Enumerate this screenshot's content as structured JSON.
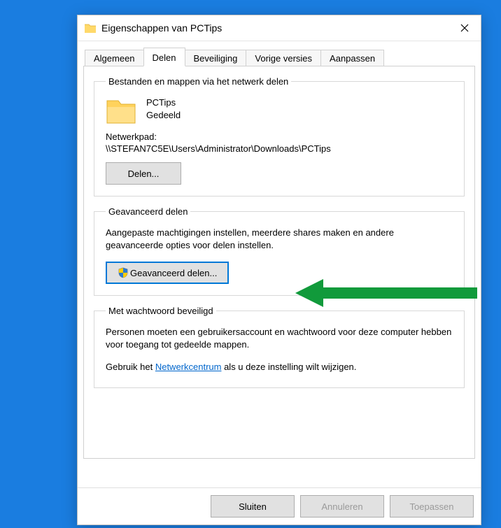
{
  "window": {
    "title": "Eigenschappen van PCTips"
  },
  "tabs": {
    "general": "Algemeen",
    "sharing": "Delen",
    "security": "Beveiliging",
    "previous": "Vorige versies",
    "customize": "Aanpassen"
  },
  "share": {
    "group_title": "Bestanden en mappen via het netwerk delen",
    "name": "PCTips",
    "status": "Gedeeld",
    "path_label": "Netwerkpad:",
    "path_value": "\\\\STEFAN7C5E\\Users\\Administrator\\Downloads\\PCTips",
    "share_btn": "Delen..."
  },
  "advanced": {
    "group_title": "Geavanceerd delen",
    "desc": "Aangepaste machtigingen instellen, meerdere shares maken en andere geavanceerde opties voor delen instellen.",
    "btn": "Geavanceerd delen..."
  },
  "password": {
    "group_title": "Met wachtwoord beveiligd",
    "line1": "Personen moeten een gebruikersaccount en wachtwoord voor deze computer hebben voor toegang tot gedeelde mappen.",
    "line2a": "Gebruik het ",
    "link": "Netwerkcentrum",
    "line2b": " als u deze instelling wilt wijzigen."
  },
  "buttons": {
    "close": "Sluiten",
    "cancel": "Annuleren",
    "apply": "Toepassen"
  }
}
